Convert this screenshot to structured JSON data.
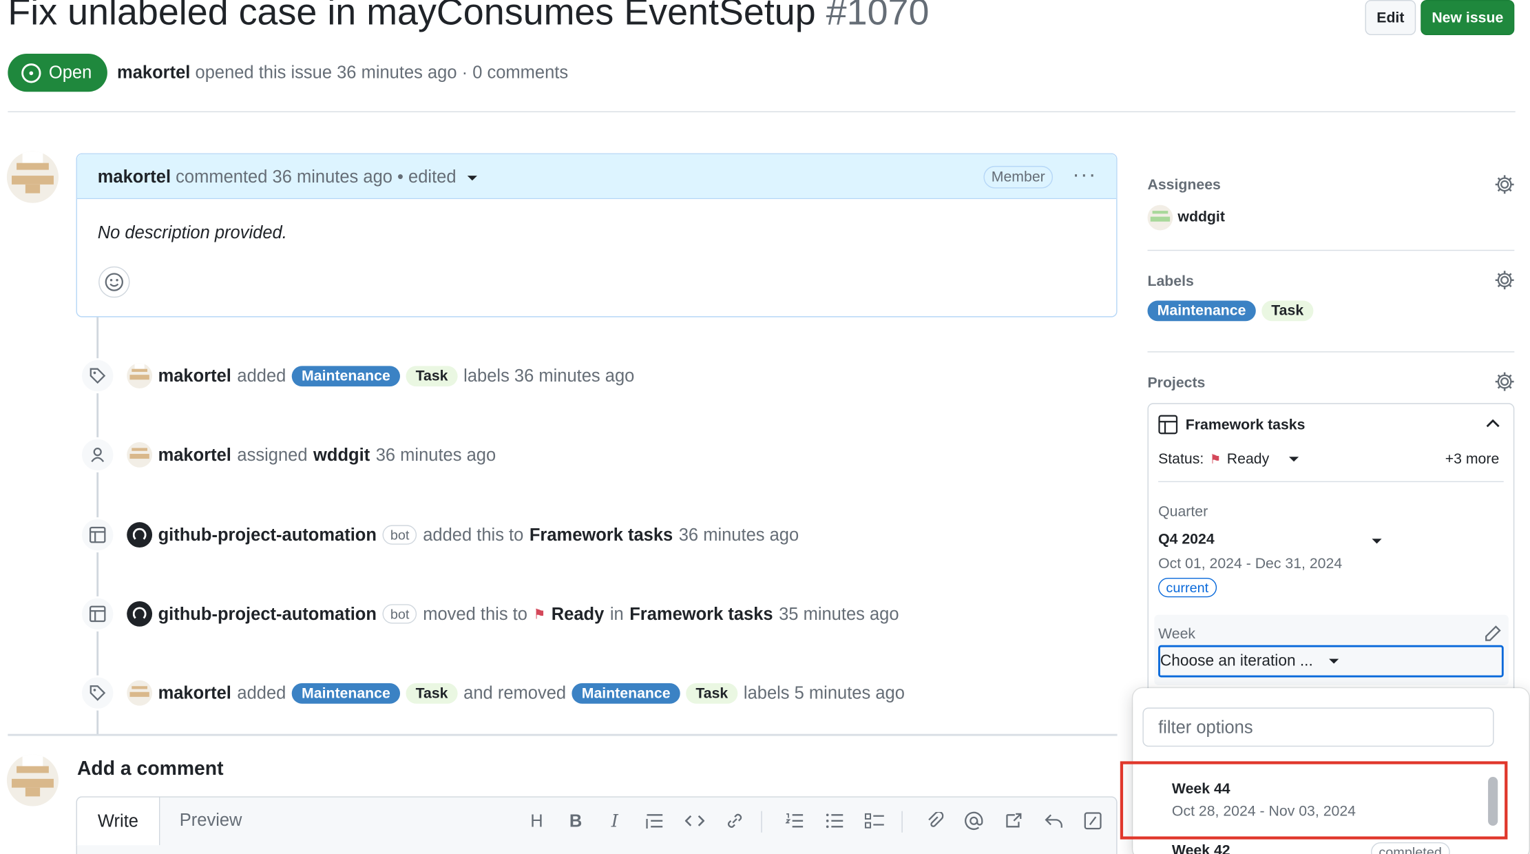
{
  "issue": {
    "title": "Fix unlabeled case in mayConsumes EventSetup",
    "number": "#1070",
    "state": "Open",
    "author": "makortel",
    "meta_rest": "opened this issue 36 minutes ago · 0 comments"
  },
  "header_buttons": {
    "edit": "Edit",
    "new_issue": "New issue"
  },
  "comment": {
    "author": "makortel",
    "meta": "commented 36 minutes ago • edited",
    "role": "Member",
    "more": "···",
    "body": "No description provided."
  },
  "timeline": [
    {
      "actor": "makortel",
      "verb": "added",
      "labels": [
        "Maintenance",
        "Task"
      ],
      "tail": "labels 36 minutes ago"
    },
    {
      "actor": "makortel",
      "verb": "assigned",
      "target": "wddgit",
      "tail": "36 minutes ago"
    },
    {
      "actor": "github-project-automation",
      "badge": "bot",
      "verb": "added this to",
      "target": "Framework tasks",
      "tail": "36 minutes ago"
    },
    {
      "actor": "github-project-automation",
      "badge": "bot",
      "verb": "moved this to",
      "status": "Ready",
      "mid": "in",
      "target": "Framework tasks",
      "tail": "35 minutes ago"
    },
    {
      "actor": "makortel",
      "verb": "added",
      "labels": [
        "Maintenance",
        "Task"
      ],
      "mid": "and removed",
      "labels2": [
        "Maintenance",
        "Task"
      ],
      "tail": "labels 5 minutes ago"
    }
  ],
  "add_comment": {
    "title": "Add a comment",
    "tab_write": "Write",
    "tab_preview": "Preview",
    "toolbar": [
      "H",
      "B",
      "I"
    ]
  },
  "sidebar": {
    "assignees_title": "Assignees",
    "assignee": "wddgit",
    "labels_title": "Labels",
    "labels": [
      "Maintenance",
      "Task"
    ],
    "projects_title": "Projects",
    "project_name": "Framework tasks",
    "status_label": "Status:",
    "status_value": "Ready",
    "more": "+3 more",
    "quarter_label": "Quarter",
    "quarter_value": "Q4 2024",
    "quarter_range": "Oct 01, 2024 - Dec 31, 2024",
    "quarter_badge": "current",
    "week_label": "Week",
    "week_placeholder": "Choose an iteration ..."
  },
  "dropdown": {
    "filter_placeholder": "filter options",
    "options": [
      {
        "name": "Week 44",
        "range": "Oct 28, 2024 - Nov 03, 2024"
      },
      {
        "name": "Week 42",
        "badge": "completed"
      }
    ]
  },
  "colors": {
    "open_green": "#1f883d",
    "label_maintenance": "#3b82c4",
    "label_task": "#eaf7e2",
    "highlight_red": "#e0372b",
    "focus_blue": "#0969da"
  }
}
